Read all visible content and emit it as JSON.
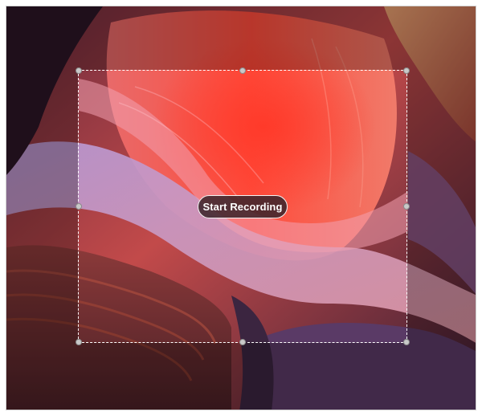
{
  "recording": {
    "start_button_label": "Start Recording"
  },
  "desktop": {
    "wallpaper_subject": "antelope-canyon-sandstone-wallpaper",
    "colors": {
      "selection_border": "#ffffff",
      "handle_fill": "#c9c9c9",
      "button_background": "#3e262c",
      "button_text": "#ffffff"
    }
  },
  "selection": {
    "handles": [
      "top-left",
      "top-center",
      "top-right",
      "middle-left",
      "middle-right",
      "bottom-left",
      "bottom-center",
      "bottom-right"
    ]
  }
}
